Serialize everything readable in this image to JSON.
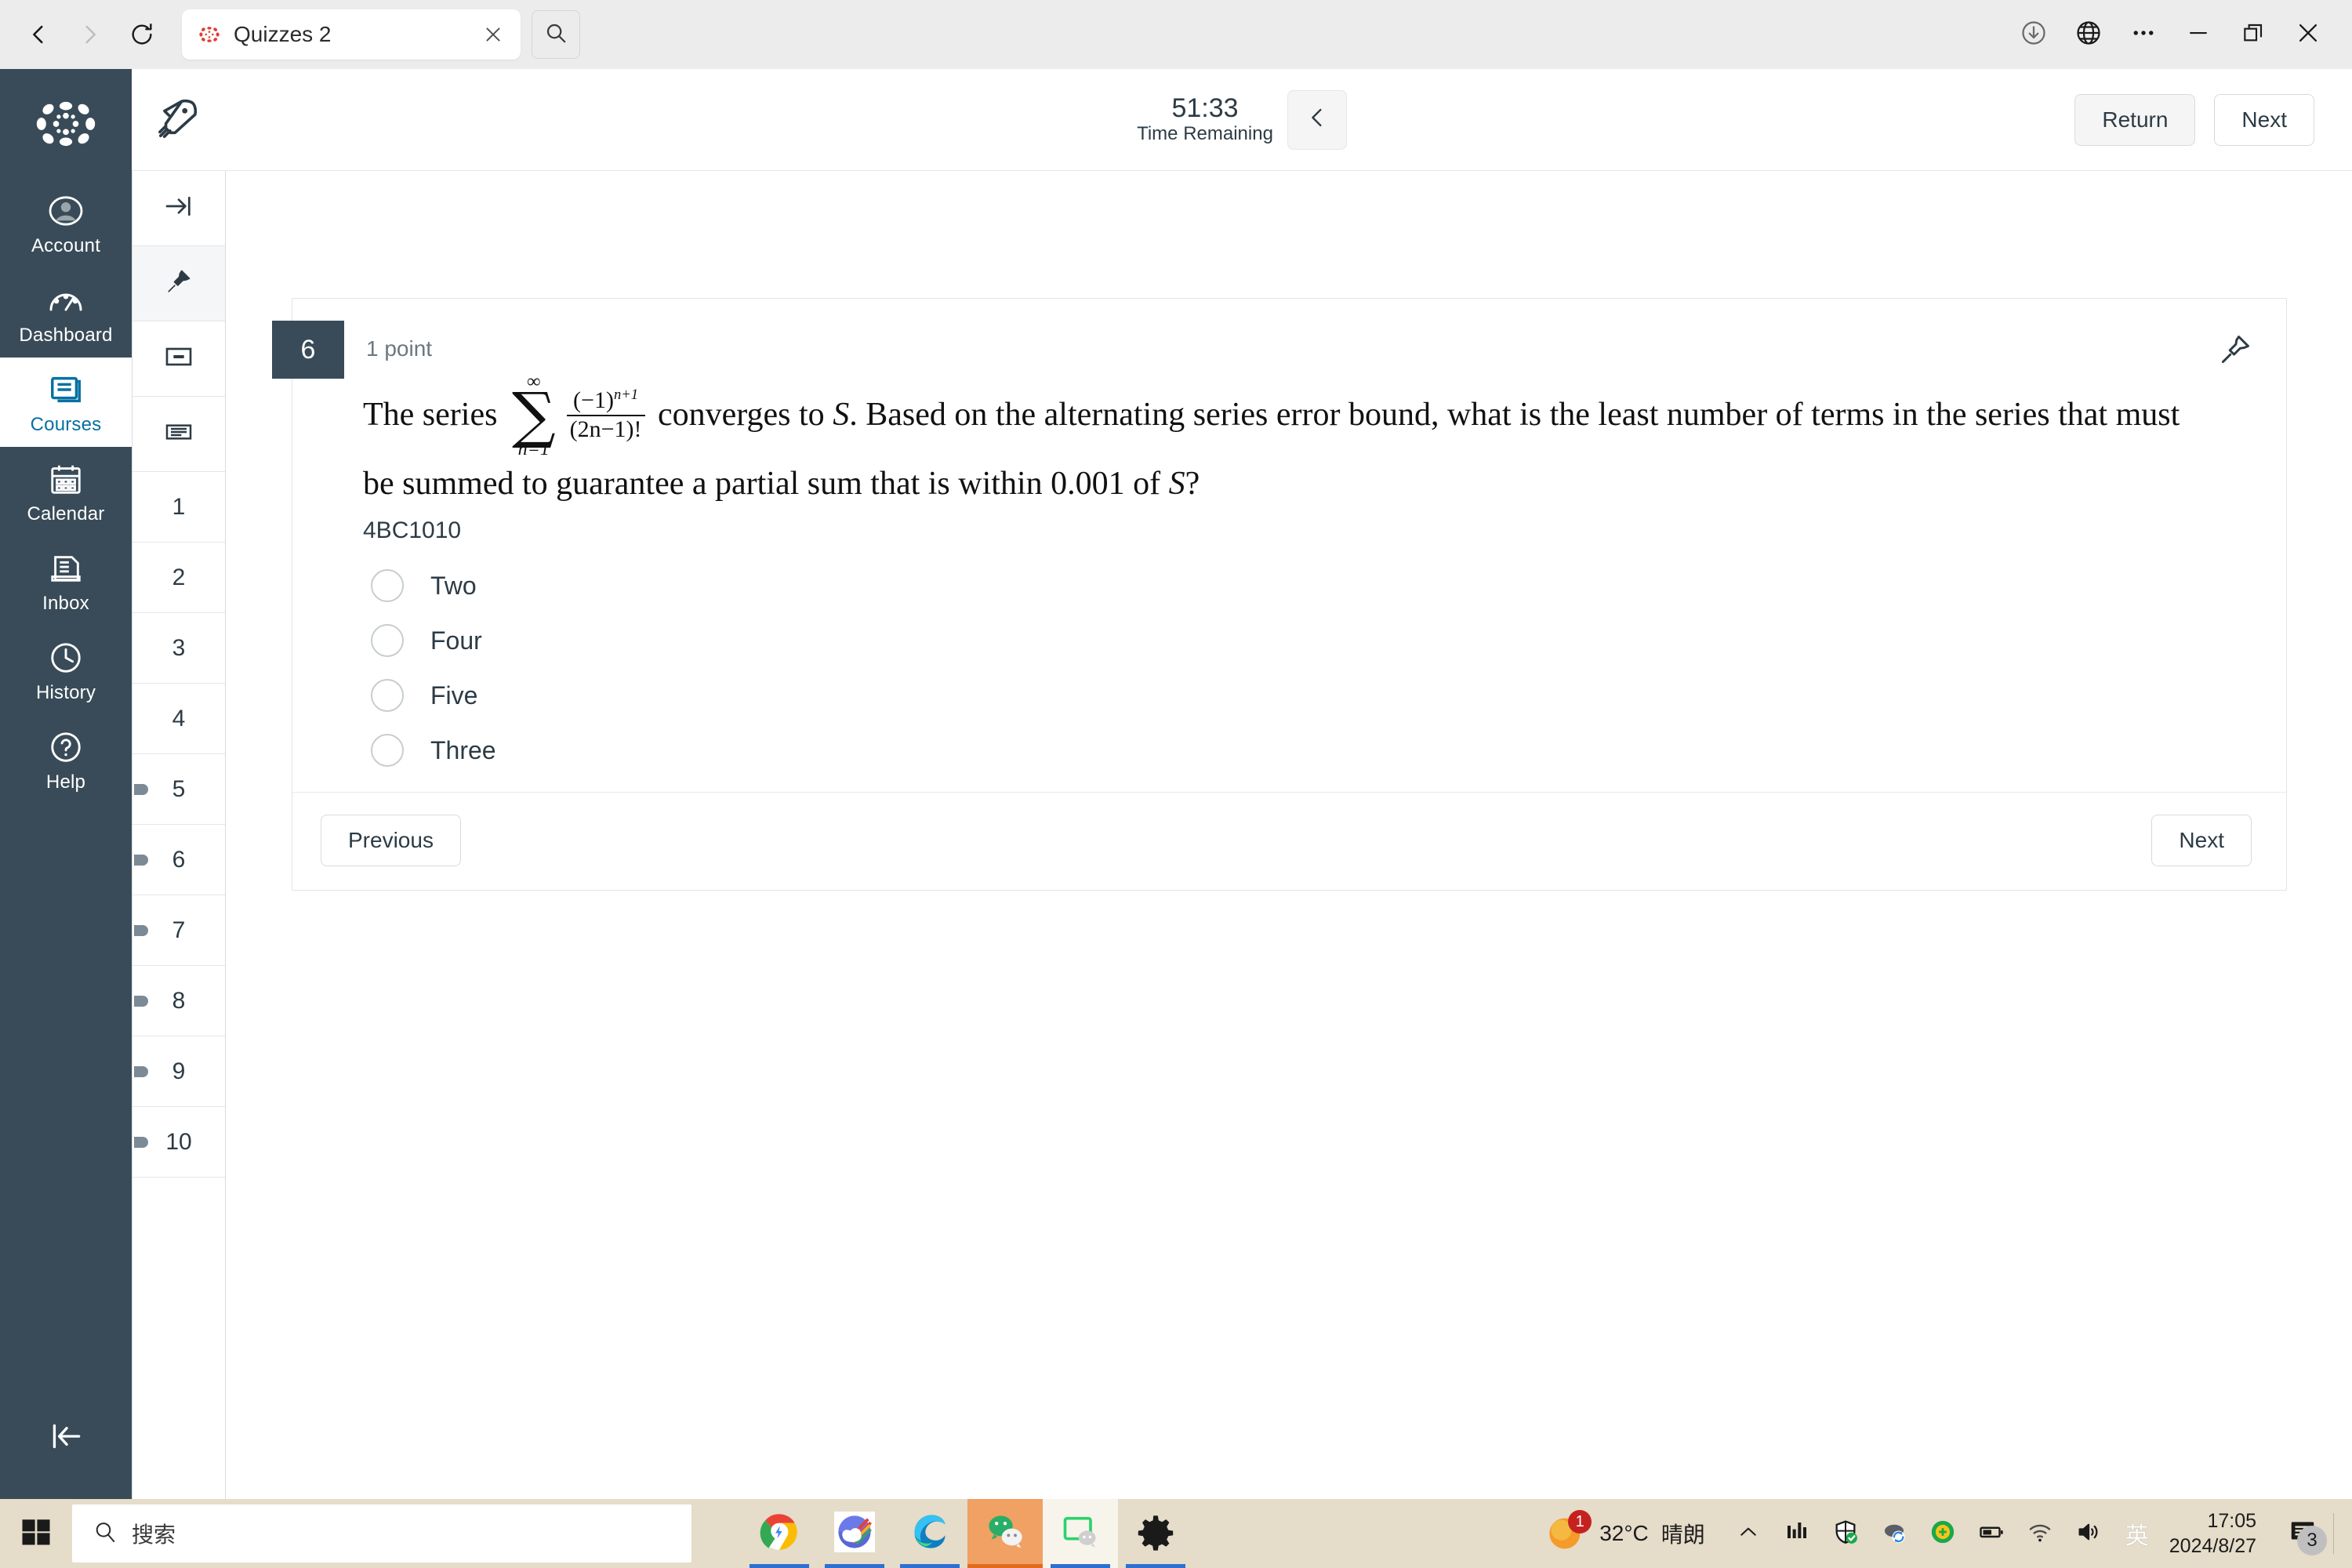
{
  "browser": {
    "back_icon": "back-chevron-icon",
    "forward_icon": "forward-chevron-icon",
    "reload_icon": "reload-icon",
    "tab": {
      "title": "Quizzes 2",
      "favicon": "canvas-logo-icon",
      "close_icon": "close-icon"
    },
    "tab_search_icon": "search-icon",
    "right_icons": [
      "download-icon",
      "translate-globe-icon",
      "more-options-icon",
      "minimize-icon",
      "restore-icon",
      "close-window-icon"
    ]
  },
  "canvas_nav": {
    "logo": "canvas-logo",
    "items": [
      {
        "label": "Account",
        "icon": "user-avatar-icon",
        "active": false
      },
      {
        "label": "Dashboard",
        "icon": "dashboard-gauge-icon",
        "active": false
      },
      {
        "label": "Courses",
        "icon": "courses-book-icon",
        "active": true
      },
      {
        "label": "Calendar",
        "icon": "calendar-icon",
        "active": false
      },
      {
        "label": "Inbox",
        "icon": "inbox-tray-icon",
        "active": false
      },
      {
        "label": "History",
        "icon": "clock-icon",
        "active": false
      },
      {
        "label": "Help",
        "icon": "help-question-icon",
        "active": false
      }
    ],
    "collapse_icon": "collapse-left-icon"
  },
  "question_rail": {
    "tools": [
      {
        "icon": "expand-right-icon",
        "selected": false
      },
      {
        "icon": "pin-icon",
        "selected": true
      },
      {
        "icon": "single-card-icon",
        "selected": false
      },
      {
        "icon": "list-view-icon",
        "selected": false
      }
    ],
    "questions": [
      {
        "number": "1",
        "marked": false
      },
      {
        "number": "2",
        "marked": false
      },
      {
        "number": "3",
        "marked": false
      },
      {
        "number": "4",
        "marked": false
      },
      {
        "number": "5",
        "marked": true
      },
      {
        "number": "6",
        "marked": true
      },
      {
        "number": "7",
        "marked": true
      },
      {
        "number": "8",
        "marked": true
      },
      {
        "number": "9",
        "marked": true
      },
      {
        "number": "10",
        "marked": true
      }
    ]
  },
  "quiz_header": {
    "rocket_icon": "rocket-icon",
    "timer_value": "51:33",
    "timer_label": "Time Remaining",
    "timer_toggle_icon": "chevron-left-icon",
    "return_label": "Return",
    "next_label": "Next"
  },
  "question": {
    "number": "6",
    "points": "1 point",
    "pin_icon": "pin-icon",
    "text_part1": "The series",
    "sum_upper": "∞",
    "sum_lower": "n=1",
    "sum_symbol": "∑",
    "frac_numerator": "(−1)",
    "frac_num_exp": "n+1",
    "frac_denominator": "(2n−1)!",
    "text_part2": "converges to",
    "var_s": "S",
    "text_part3": ". Based on the alternating series error bound, what is the least number of terms in the series that must be summed to guarantee a partial sum that is within",
    "tolerance": "0.001",
    "text_part4": "of",
    "text_part5": "?",
    "code": "4BC1010",
    "answers": [
      {
        "label": "Two",
        "selected": false
      },
      {
        "label": "Four",
        "selected": false
      },
      {
        "label": "Five",
        "selected": false
      },
      {
        "label": "Three",
        "selected": false
      }
    ],
    "previous_label": "Previous",
    "next_label": "Next"
  },
  "taskbar": {
    "start_icon": "windows-start-icon",
    "search_icon": "search-icon",
    "search_placeholder": "搜索",
    "apps": [
      {
        "name": "chrome-icon",
        "state": "open"
      },
      {
        "name": "rainbow-cloud-app-icon",
        "state": "open"
      },
      {
        "name": "edge-icon",
        "state": "open"
      },
      {
        "name": "wechat-icon",
        "state": "active"
      },
      {
        "name": "wechat-devtools-icon",
        "state": "active-light"
      },
      {
        "name": "settings-gear-icon",
        "state": "open"
      }
    ],
    "weather": {
      "temperature": "32°C",
      "condition": "晴朗",
      "badge": "1"
    },
    "tray_icons": [
      "show-hidden-icons-chevron",
      "monitor-bars-icon",
      "security-shield-icon",
      "onedrive-sync-icon",
      "green-plus-icon",
      "battery-icon",
      "wifi-icon",
      "volume-icon"
    ],
    "ime": "英",
    "clock_time": "17:05",
    "clock_date": "2024/8/27",
    "notifications_badge": "3"
  },
  "colors": {
    "canvas_nav_bg": "#394b58",
    "canvas_active_text": "#0770a3",
    "taskbar_bg": "#e5dcc9",
    "badge_red": "#c5221f"
  }
}
